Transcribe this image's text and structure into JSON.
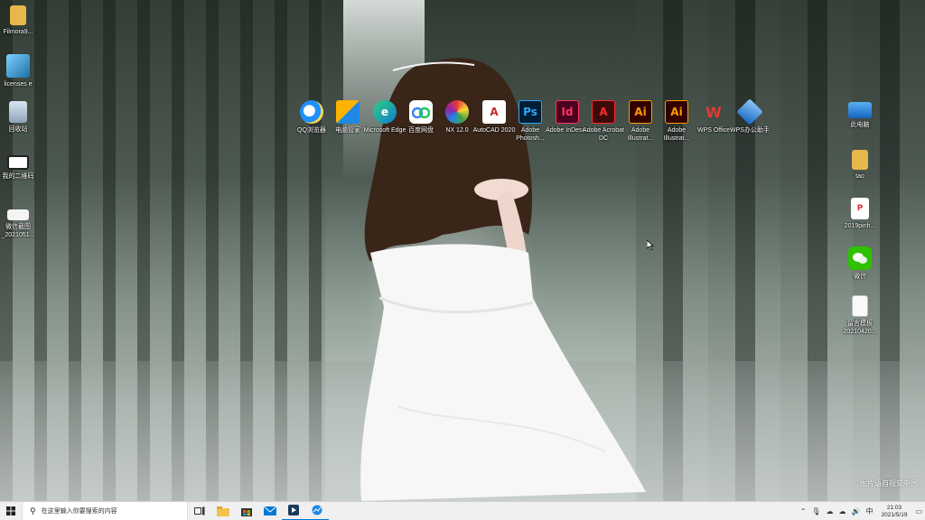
{
  "desktop": {
    "left_icons": [
      {
        "label": "Filmora9...",
        "icon": "folder-icon"
      },
      {
        "label": "licenses e",
        "icon": "license-file-icon"
      },
      {
        "label": "回收站",
        "icon": "recycle-bin-icon"
      },
      {
        "label": "我的二维码",
        "icon": "qrcode-image-icon"
      },
      {
        "label": "微信截图_2021051...",
        "icon": "image-file-icon"
      }
    ],
    "top_icons": [
      {
        "label": "QQ浏览器",
        "icon": "qq-browser-icon",
        "glyph": "",
        "color": "#1e90ff"
      },
      {
        "label": "电脑管家",
        "icon": "pc-manager-icon",
        "glyph": "",
        "color": "#2e7d32"
      },
      {
        "label": "Microsoft Edge",
        "icon": "edge-icon",
        "glyph": "e",
        "color": "#0f7bd6"
      },
      {
        "label": "百度网盘",
        "icon": "baidu-netdisk-icon",
        "glyph": "",
        "color": "#3b82f6"
      },
      {
        "label": "NX 12.0",
        "icon": "nx-icon",
        "glyph": "",
        "color": "#e0e0ff"
      },
      {
        "label": "AutoCAD 2020",
        "icon": "autocad-icon",
        "glyph": "A",
        "color": "#c62828"
      },
      {
        "label": "Adobe Photosh...",
        "icon": "photoshop-icon",
        "glyph": "Ps",
        "color": "#001d34"
      },
      {
        "label": "Adobe InDesi...",
        "icon": "indesign-icon",
        "glyph": "Id",
        "color": "#49021f"
      },
      {
        "label": "Adobe Acrobat DC",
        "icon": "acrobat-icon",
        "glyph": "A",
        "color": "#3c0a0a"
      },
      {
        "label": "Adobe Illustrat...",
        "icon": "illustrator-icon",
        "glyph": "Ai",
        "color": "#330000"
      },
      {
        "label": "Adobe Illustrat...",
        "icon": "illustrator-icon",
        "glyph": "Ai",
        "color": "#330000"
      },
      {
        "label": "WPS Office",
        "icon": "wps-office-icon",
        "glyph": "W",
        "color": "#d32f2f"
      },
      {
        "label": "WPS办公助手",
        "icon": "wps-assistant-icon",
        "glyph": "",
        "color": "#1e88e5"
      }
    ],
    "right_icons": [
      {
        "label": "此电脑",
        "icon": "this-pc-icon"
      },
      {
        "label": "tao",
        "icon": "user-folder-icon"
      },
      {
        "label": "2019pinh...",
        "icon": "pdf-file-icon"
      },
      {
        "label": "微信",
        "icon": "wechat-icon"
      },
      {
        "label": "留言模板20210420...",
        "icon": "text-file-icon"
      }
    ]
  },
  "taskbar": {
    "search_placeholder": "在这里输入你要搜索的内容",
    "pinned_apps": [
      "task-view-icon",
      "file-explorer-icon",
      "store-icon",
      "mail-icon",
      "media-app-icon",
      "photo-app-icon"
    ],
    "time": "21:03",
    "date": "2021/5/19"
  },
  "watermark": "图片语自视觉中国"
}
